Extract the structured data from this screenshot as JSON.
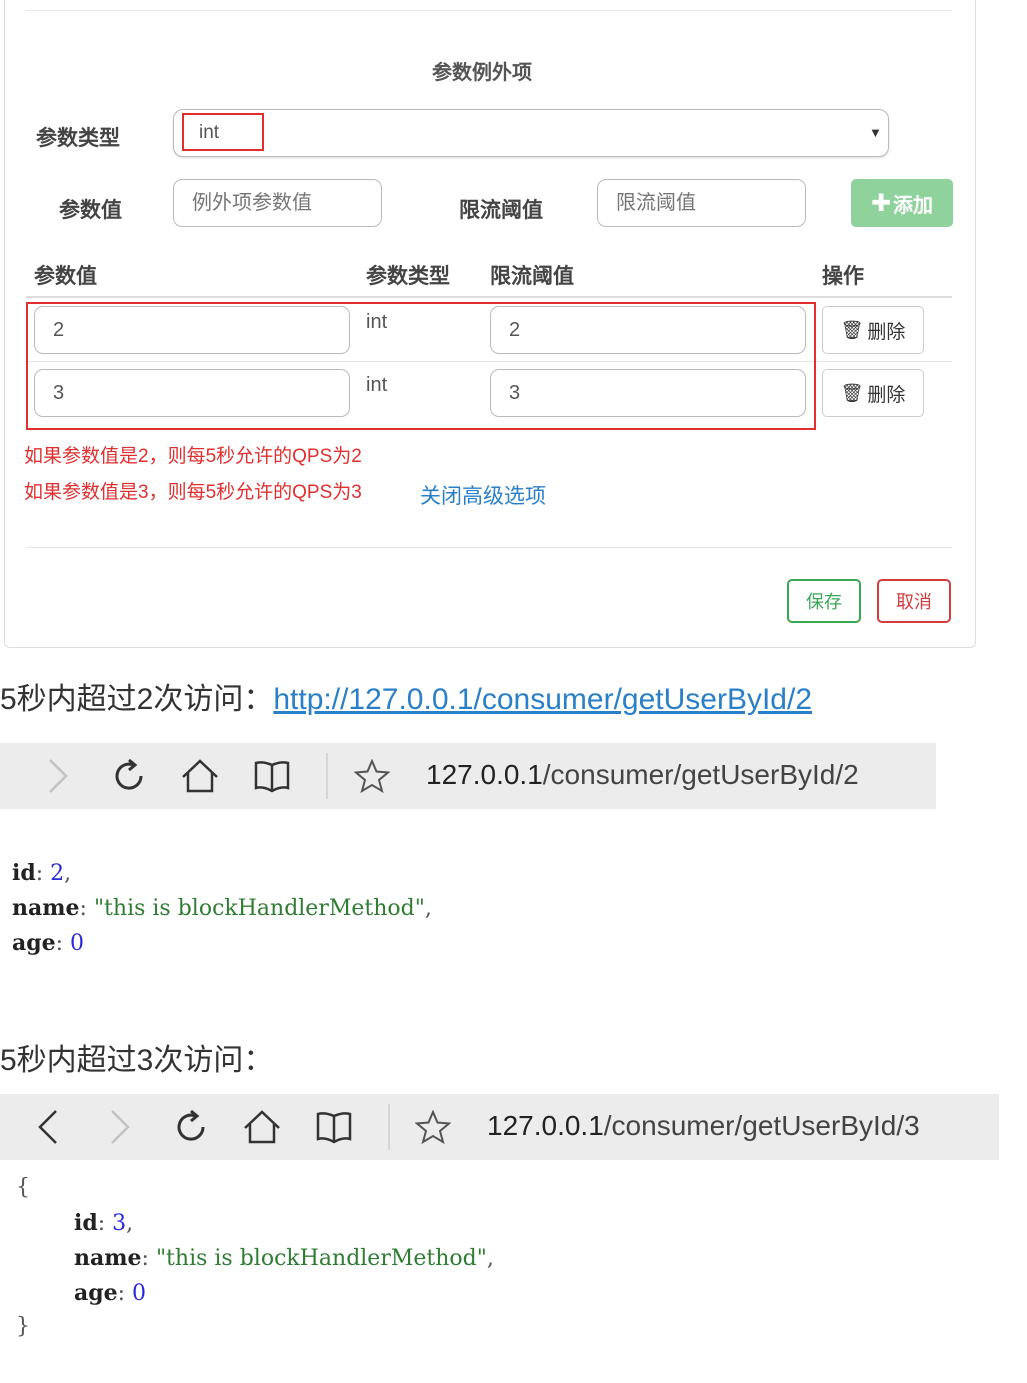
{
  "dialog": {
    "section_title": "参数例外项",
    "param_type_label": "参数类型",
    "param_type_value": "int",
    "param_value_label": "参数值",
    "param_value_placeholder": "例外项参数值",
    "threshold_label": "限流阈值",
    "threshold_placeholder": "限流阈值",
    "add_button": "添加",
    "table": {
      "headers": [
        "参数值",
        "参数类型",
        "限流阈值",
        "操作"
      ],
      "rows": [
        {
          "value": "2",
          "type": "int",
          "threshold": "2",
          "action": "删除"
        },
        {
          "value": "3",
          "type": "int",
          "threshold": "3",
          "action": "删除"
        }
      ]
    },
    "notes": [
      "如果参数值是2，则每5秒允许的QPS为2",
      "如果参数值是3，则每5秒允许的QPS为3"
    ],
    "toggle_link": "关闭高级选项",
    "save_button": "保存",
    "cancel_button": "取消"
  },
  "article": {
    "para1_text": "5秒内超过2次访问：",
    "para1_link": "http://127.0.0.1/consumer/getUserById/2",
    "para2_text": "5秒内超过3次访问："
  },
  "browser1": {
    "url_host": "127.0.0.1",
    "url_path": "/consumer/getUserById/2"
  },
  "json1": {
    "id_key": "id",
    "id_val": "2",
    "name_key": "name",
    "name_val": "\"this is blockHandlerMethod\"",
    "age_key": "age",
    "age_val": "0"
  },
  "browser2": {
    "url_host": "127.0.0.1",
    "url_path": "/consumer/getUserById/3"
  },
  "json2": {
    "open_brace": "{",
    "id_key": "id",
    "id_val": "3",
    "name_key": "name",
    "name_val": "\"this is blockHandlerMethod\"",
    "age_key": "age",
    "age_val": "0",
    "close_brace": "}"
  },
  "icons": {
    "back": "chevron-left-icon",
    "forward": "chevron-right-icon",
    "reload": "reload-icon",
    "home": "home-icon",
    "reader": "book-icon",
    "bookmark": "star-icon",
    "trash": "trash-icon",
    "plus": "plus-icon",
    "dropdown": "caret-down-icon"
  },
  "colors": {
    "highlight_red": "#e02f2f",
    "link_blue": "#2a7fc9",
    "add_green": "#8fd29c",
    "save_green": "#3aa757",
    "cancel_red": "#d33c3c"
  }
}
